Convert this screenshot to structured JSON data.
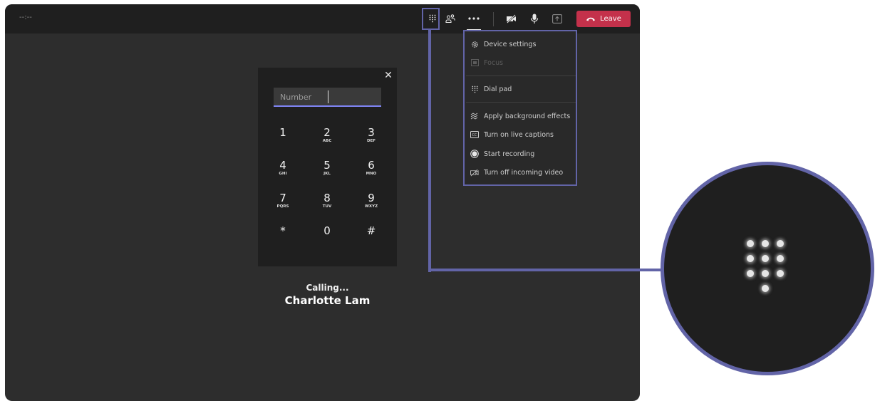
{
  "topbar": {
    "timer": "--:--",
    "leave_label": "Leave",
    "icons": [
      "dialpad-icon",
      "participants-icon",
      "more-icon",
      "camera-off-icon",
      "mic-icon",
      "share-icon",
      "hangup-icon"
    ]
  },
  "menu": {
    "items": [
      {
        "label": "Device settings",
        "icon": "gear-icon",
        "enabled": true
      },
      {
        "label": "Focus",
        "icon": "focus-icon",
        "enabled": false
      },
      {
        "label": "Dial pad",
        "icon": "dialpad-icon",
        "enabled": true
      },
      {
        "label": "Apply background effects",
        "icon": "background-effects-icon",
        "enabled": true
      },
      {
        "label": "Turn on live captions",
        "icon": "captions-icon",
        "enabled": true
      },
      {
        "label": "Start recording",
        "icon": "record-icon",
        "enabled": true
      },
      {
        "label": "Turn off incoming video",
        "icon": "video-off-icon",
        "enabled": true
      }
    ]
  },
  "dialpad": {
    "placeholder": "Number",
    "keys": [
      {
        "digit": "1",
        "letters": ""
      },
      {
        "digit": "2",
        "letters": "ABC"
      },
      {
        "digit": "3",
        "letters": "DEF"
      },
      {
        "digit": "4",
        "letters": "GHI"
      },
      {
        "digit": "5",
        "letters": "JKL"
      },
      {
        "digit": "6",
        "letters": "MNO"
      },
      {
        "digit": "7",
        "letters": "PQRS"
      },
      {
        "digit": "8",
        "letters": "TUV"
      },
      {
        "digit": "9",
        "letters": "WXYZ"
      },
      {
        "digit": "*",
        "letters": ""
      },
      {
        "digit": "0",
        "letters": ""
      },
      {
        "digit": "#",
        "letters": ""
      }
    ]
  },
  "call": {
    "status": "Calling...",
    "callee": "Charlotte Lam"
  },
  "colors": {
    "accent": "#6264a7",
    "leave": "#c4314b",
    "stage": "#2d2d2d",
    "bar": "#1f1f1f"
  }
}
